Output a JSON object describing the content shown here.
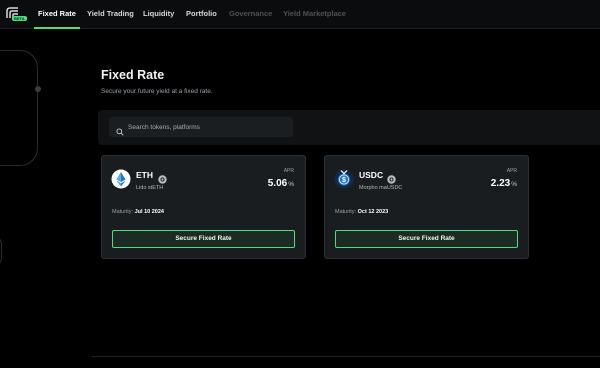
{
  "nav": {
    "badge": "BETA",
    "items": [
      {
        "label": "Fixed Rate",
        "state": "active"
      },
      {
        "label": "Yield Trading",
        "state": "normal"
      },
      {
        "label": "Liquidity",
        "state": "normal"
      },
      {
        "label": "Portfolio",
        "state": "normal"
      },
      {
        "label": "Governance",
        "state": "disabled"
      },
      {
        "label": "Yield Marketplace",
        "state": "disabled"
      }
    ]
  },
  "page": {
    "title": "Fixed Rate",
    "subtitle": "Secure your future yield at a fixed rate."
  },
  "search": {
    "placeholder": "Search tokens, platforms",
    "value": "",
    "icon": "search-icon"
  },
  "cards": [
    {
      "symbol": "ETH",
      "platform": "Lido stETH",
      "apr_label": "APR",
      "apr_value": "5.06",
      "apr_unit": "%",
      "maturity_label": "Maturity:",
      "maturity_date": "Jul 10 2024",
      "button_label": "Secure Fixed Rate",
      "icon": "eth-icon"
    },
    {
      "symbol": "USDC",
      "platform": "Morpho maUSDC",
      "apr_label": "APR",
      "apr_value": "2.23",
      "apr_unit": "%",
      "maturity_label": "Maturity:",
      "maturity_date": "Oct 12 2023",
      "button_label": "Secure Fixed Rate",
      "icon": "usdc-icon"
    }
  ],
  "colors": {
    "accent": "#4ade80",
    "background": "#000000",
    "card": "#1a1d1f",
    "eth_blue": "#627eea",
    "usdc_blue": "#2775ca"
  }
}
